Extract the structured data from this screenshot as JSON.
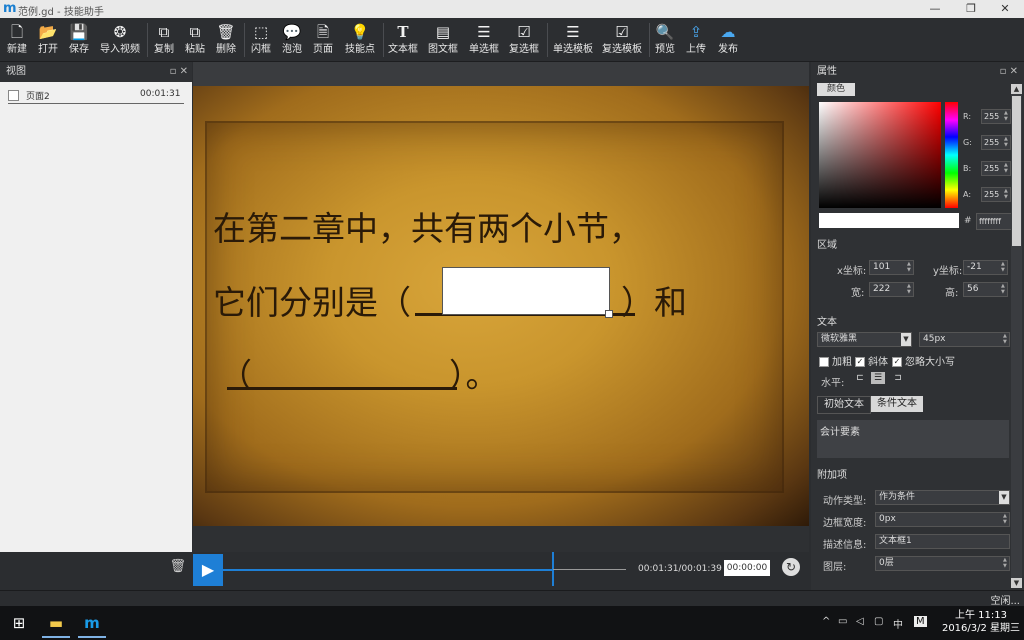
{
  "window": {
    "title": "范例.gd - 技能助手",
    "logo": "m",
    "min": "—",
    "restore": "❐",
    "close": "✕"
  },
  "toolbar": [
    {
      "label": "新建",
      "icon": "file-new-icon",
      "glyph": "🗋"
    },
    {
      "label": "打开",
      "icon": "folder-open-icon",
      "glyph": "📂"
    },
    {
      "label": "保存",
      "icon": "save-icon",
      "glyph": "💾"
    },
    {
      "label": "导入视频",
      "icon": "video-reel-icon",
      "glyph": "❂"
    },
    {
      "label": "复制",
      "icon": "copy-icon",
      "glyph": "⧉"
    },
    {
      "label": "粘贴",
      "icon": "paste-icon",
      "glyph": "⧉"
    },
    {
      "label": "删除",
      "icon": "trash-icon",
      "glyph": "🗑"
    },
    {
      "label": "闪框",
      "icon": "flash-frame-icon",
      "glyph": "⬚"
    },
    {
      "label": "泡泡",
      "icon": "bubble-icon",
      "glyph": "💬"
    },
    {
      "label": "页面",
      "icon": "page-icon",
      "glyph": "🗎"
    },
    {
      "label": "技能点",
      "icon": "lightbulb-icon",
      "glyph": "💡"
    },
    {
      "label": "文本框",
      "icon": "text-box-icon",
      "glyph": "T"
    },
    {
      "label": "图文框",
      "icon": "image-text-icon",
      "glyph": "▤"
    },
    {
      "label": "单选框",
      "icon": "radio-list-icon",
      "glyph": "☰"
    },
    {
      "label": "复选框",
      "icon": "checkbox-list-icon",
      "glyph": "☑"
    },
    {
      "label": "单选模板",
      "icon": "radio-template-icon",
      "glyph": "☰"
    },
    {
      "label": "复选模板",
      "icon": "checkbox-template-icon",
      "glyph": "☑"
    },
    {
      "label": "预览",
      "icon": "preview-search-icon",
      "glyph": "🔍"
    },
    {
      "label": "上传",
      "icon": "upload-icon",
      "glyph": "⇪"
    },
    {
      "label": "发布",
      "icon": "cloud-publish-icon",
      "glyph": "☁"
    }
  ],
  "left_panel": {
    "title": "视图",
    "pin": "▫",
    "close": "✕",
    "pages": [
      {
        "name": "页面2",
        "time": "00:01:31"
      }
    ],
    "trash": "🗑"
  },
  "slide": {
    "line1": "在第二章中，共有两个小节，",
    "line2a": "它们分别是（",
    "line2b": "）和",
    "line3a": "（",
    "line3b": "）。"
  },
  "timeline": {
    "play": "▶",
    "progress": 0.82,
    "time": "00:01:31/00:01:39",
    "current": "00:00:00",
    "reset": "↻"
  },
  "properties": {
    "title": "属性",
    "pin": "▫",
    "close": "✕",
    "color_tab": "颜色",
    "r_label": "R:",
    "r": "255",
    "g_label": "G:",
    "g": "255",
    "b_label": "B:",
    "b": "255",
    "a_label": "A:",
    "a": "255",
    "hex_label": "#",
    "hex": "ffffffff",
    "region_title": "区域",
    "x_label": "x坐标:",
    "x": "101",
    "y_label": "y坐标:",
    "y": "-21",
    "w_label": "宽:",
    "w": "222",
    "h_label": "高:",
    "h": "56",
    "text_title": "文本",
    "font": "微软雅黑",
    "font_size": "45px",
    "bold": "加粗",
    "italic": "斜体",
    "ignore_case": "忽略大小写",
    "halign_label": "水平:",
    "tab_initial": "初始文本",
    "tab_condition": "条件文本",
    "condition_text": "会计要素",
    "extra_title": "附加项",
    "action_label": "动作类型:",
    "action": "作为条件",
    "border_label": "边框宽度:",
    "border": "0px",
    "desc_label": "描述信息:",
    "desc": "文本框1",
    "layer_label": "图层:",
    "layer": "0层",
    "colors": {
      "selected": "#ffffff"
    }
  },
  "status": {
    "text": "空闲..."
  },
  "taskbar": {
    "time": "上午 11:13",
    "date": "2016/3/2 星期三",
    "ime": "中",
    "ime2": "M",
    "tray_up": "^"
  }
}
